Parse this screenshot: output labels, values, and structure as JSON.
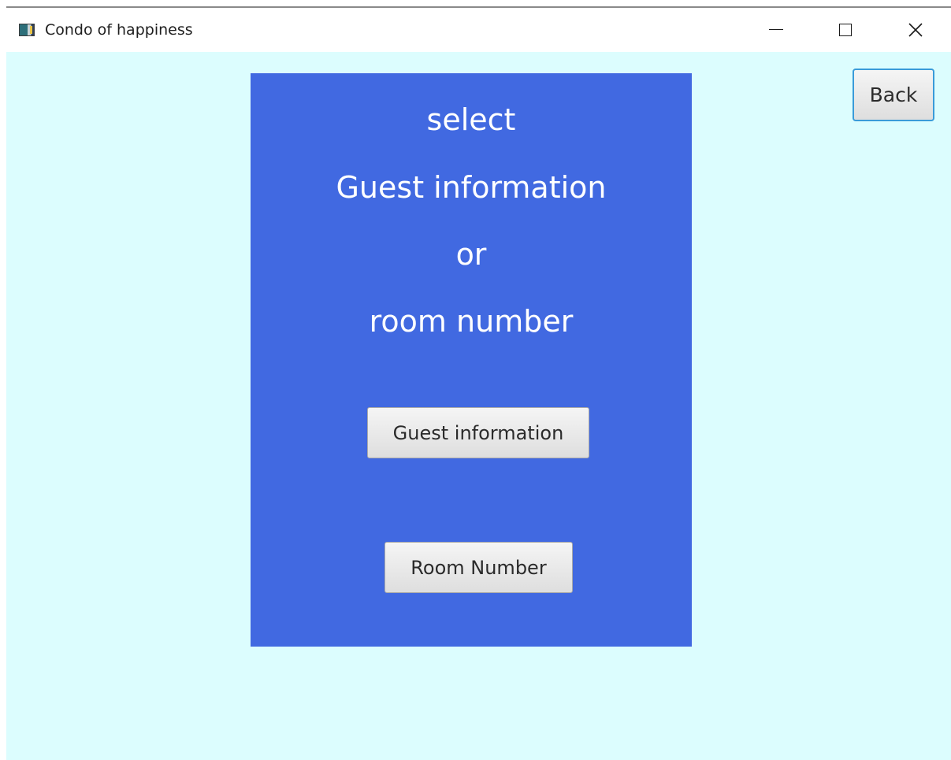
{
  "window": {
    "title": "Condo of happiness",
    "icon": "app-window-icon",
    "controls": {
      "minimize_icon": "minimize-icon",
      "maximize_icon": "maximize-icon",
      "close_icon": "close-icon",
      "close_glyph": "✕"
    }
  },
  "colors": {
    "background": "#dcfdfe",
    "panel": "#4169e1",
    "panel_text": "#ffffff",
    "back_focus_border": "#3a9bd9"
  },
  "panel": {
    "lines": [
      "select",
      "Guest information",
      "or",
      "room number"
    ]
  },
  "buttons": {
    "guest_information": "Guest information",
    "room_number": "Room Number",
    "back": "Back"
  }
}
